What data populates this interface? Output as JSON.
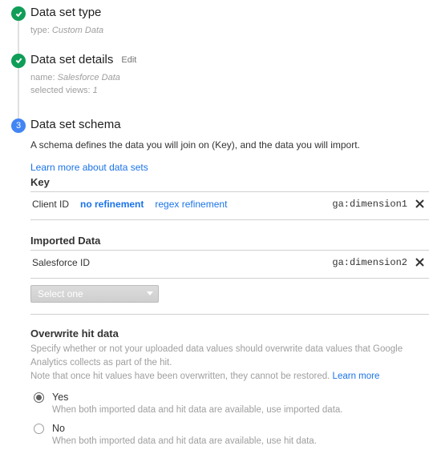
{
  "steps": {
    "type": {
      "title": "Data set type",
      "meta_label": "type:",
      "meta_value": "Custom Data"
    },
    "details": {
      "title": "Data set details",
      "edit": "Edit",
      "name_label": "name:",
      "name_value": "Salesforce Data",
      "views_label": "selected views:",
      "views_value": "1"
    },
    "schema": {
      "number": "3",
      "title": "Data set schema",
      "description": "A schema defines the data you will join on (Key), and the data you will import.",
      "learn_link": "Learn more about data sets",
      "key_label": "Key",
      "key_row": {
        "label": "Client ID",
        "no_ref": "no refinement",
        "regex_ref": "regex refinement",
        "code": "ga:dimension1"
      },
      "imported_label": "Imported Data",
      "imported_row": {
        "label": "Salesforce ID",
        "code": "ga:dimension2"
      },
      "select_placeholder": "Select one",
      "overwrite": {
        "title": "Overwrite hit data",
        "desc1": "Specify whether or not your uploaded data values should overwrite data values that Google Analytics collects as part of the hit.",
        "desc2_prefix": "Note that once hit values have been overwritten, they cannot be restored. ",
        "desc2_link": "Learn more",
        "yes": {
          "label": "Yes",
          "sub": "When both imported data and hit data are available, use imported data."
        },
        "no": {
          "label": "No",
          "sub": "When both imported data and hit data are available, use hit data."
        }
      }
    }
  }
}
